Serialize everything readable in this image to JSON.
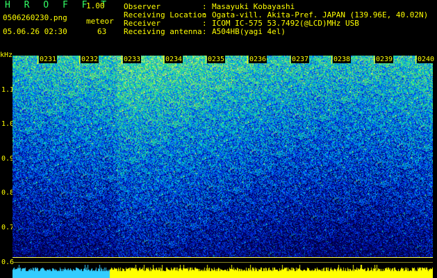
{
  "header": {
    "title": "H R O F F T",
    "version": "1.00",
    "filename": "0506260230.png",
    "datetime": "05.06.26 02:30",
    "mode": "meteor",
    "count": "63"
  },
  "info": [
    {
      "key": "Observer",
      "value": "Masayuki Kobayashi"
    },
    {
      "key": "Receiving Location",
      "value": "Ogata-vill. Akita-Pref. JAPAN (139.96E, 40.02N)"
    },
    {
      "key": "Receiver",
      "value": "ICOM IC-575 53.7492(@LCD)MHz USB"
    },
    {
      "key": "Receiving antenna",
      "value": "A504HB(yagi 4el)"
    }
  ],
  "y_axis": {
    "unit": "kHz",
    "ticks": [
      "1.1",
      "1.0",
      "0.9",
      "0.8",
      "0.7",
      "0.6"
    ]
  },
  "time_labels": [
    "0231",
    "0232",
    "0233",
    "0234",
    "0235",
    "0236",
    "0237",
    "0238",
    "0239",
    "0240"
  ],
  "colors": {
    "header_green": "#33ff66",
    "header_yellow": "#ffff00",
    "axis_yellow": "#ffff00",
    "bottom_cyan": "#33ccff"
  }
}
